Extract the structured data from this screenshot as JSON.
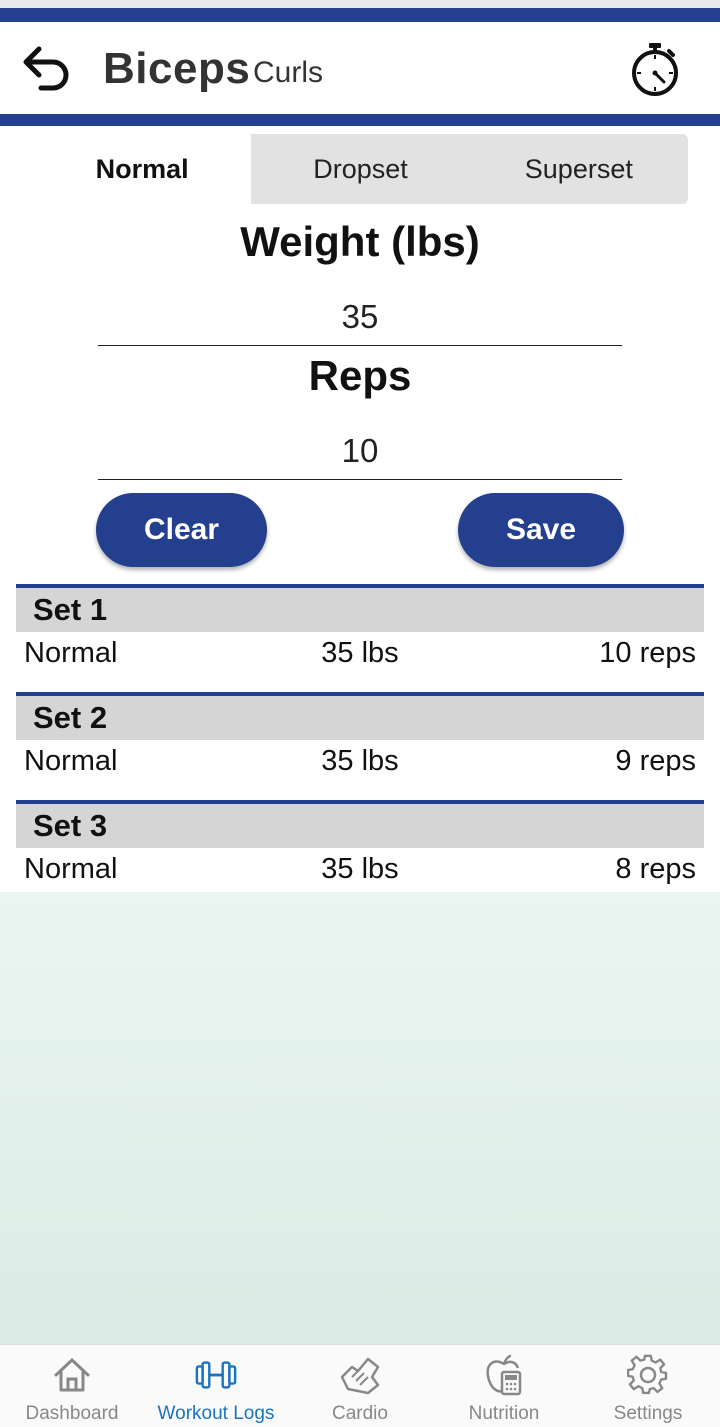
{
  "header": {
    "title": "Biceps",
    "subtitle": "Curls"
  },
  "tabs": [
    {
      "label": "Normal",
      "active": true
    },
    {
      "label": "Dropset",
      "active": false
    },
    {
      "label": "Superset",
      "active": false
    }
  ],
  "form": {
    "weight_label": "Weight (lbs)",
    "weight_value": "35",
    "reps_label": "Reps",
    "reps_value": "10",
    "clear_label": "Clear",
    "save_label": "Save"
  },
  "sets": [
    {
      "name": "Set 1",
      "type": "Normal",
      "weight": "35 lbs",
      "reps": "10 reps"
    },
    {
      "name": "Set 2",
      "type": "Normal",
      "weight": "35 lbs",
      "reps": "9 reps"
    },
    {
      "name": "Set 3",
      "type": "Normal",
      "weight": "35 lbs",
      "reps": "8 reps"
    }
  ],
  "nav": [
    {
      "label": "Dashboard",
      "icon": "home-icon",
      "active": false
    },
    {
      "label": "Workout Logs",
      "icon": "dumbbell-icon",
      "active": true
    },
    {
      "label": "Cardio",
      "icon": "shoe-icon",
      "active": false
    },
    {
      "label": "Nutrition",
      "icon": "apple-calculator-icon",
      "active": false
    },
    {
      "label": "Settings",
      "icon": "gear-icon",
      "active": false
    }
  ],
  "colors": {
    "primary": "#233f8d",
    "nav_active": "#1a73c0",
    "nav_inactive": "#888888",
    "set_header_bg": "#d5d5d5"
  }
}
